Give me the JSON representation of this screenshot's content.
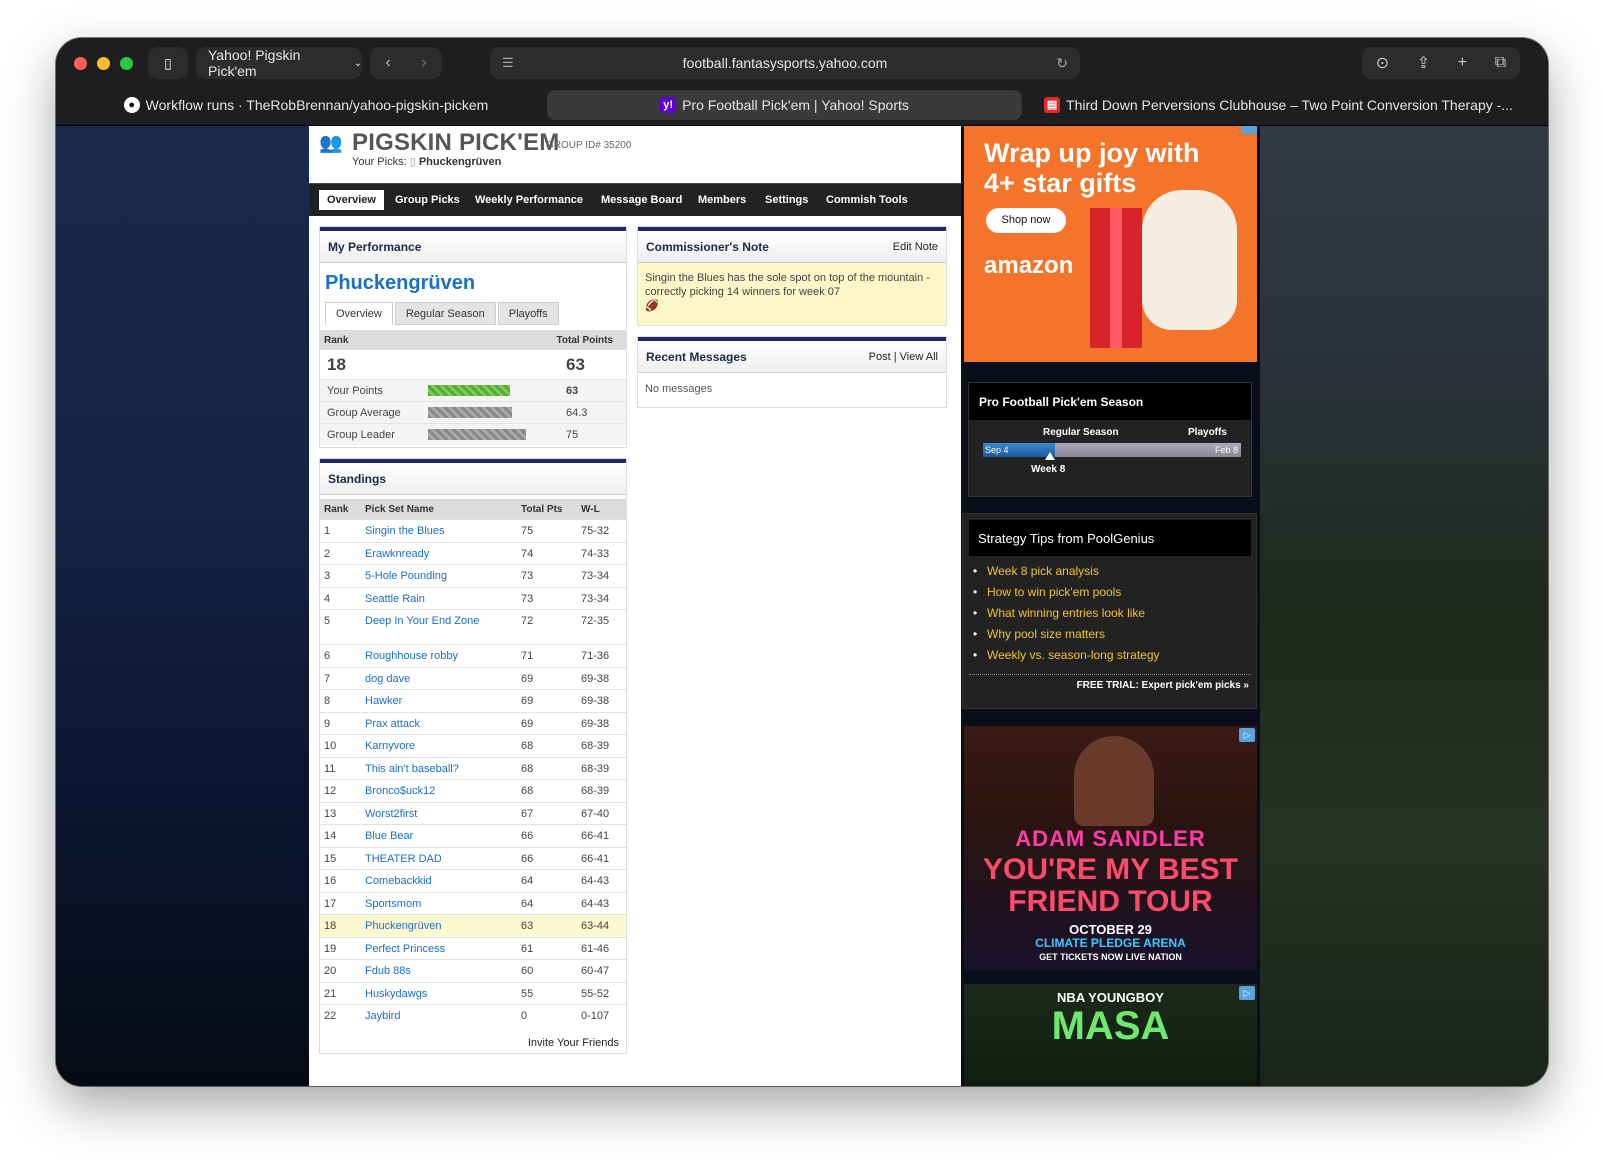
{
  "browser": {
    "tab_group": "Yahoo! Pigskin Pick'em",
    "address": "football.fantasysports.yahoo.com",
    "tabs": [
      {
        "label": "Workflow runs · TheRobBrennan/yahoo-pigskin-pickem",
        "icon": "github-icon"
      },
      {
        "label": "Pro Football Pick'em | Yahoo! Sports",
        "icon": "yahoo-icon"
      },
      {
        "label": "Third Down Perversions Clubhouse – Two Point Conversion Therapy -...",
        "icon": "tab-icon"
      }
    ]
  },
  "header": {
    "brand": "PIGSKIN PICK'EM",
    "group_id": "GROUP ID# 35200",
    "your_picks_label": "Your Picks:",
    "your_picks_value": "Phuckengrüven"
  },
  "nav": [
    "Overview",
    "Group Picks",
    "Weekly Performance",
    "Message Board",
    "Members",
    "Settings",
    "Commish Tools"
  ],
  "performance": {
    "title": "My Performance",
    "name": "Phuckengrüven",
    "tabs": [
      "Overview",
      "Regular Season",
      "Playoffs"
    ],
    "rank_label": "Rank",
    "points_label": "Total Points",
    "rank": "18",
    "total_points": "63",
    "stats": [
      {
        "label": "Your Points",
        "value": "63",
        "pct": 0.84
      },
      {
        "label": "Group Average",
        "value": "64.3",
        "pct": 0.86
      },
      {
        "label": "Group Leader",
        "value": "75",
        "pct": 1.0
      }
    ]
  },
  "standings": {
    "title": "Standings",
    "headers": [
      "Rank",
      "Pick Set Name",
      "Total Pts",
      "W-L"
    ],
    "rows": [
      [
        "1",
        "Singin the Blues",
        "75",
        "75-32"
      ],
      [
        "2",
        "Erawknready",
        "74",
        "74-33"
      ],
      [
        "3",
        "5-Hole Pounding",
        "73",
        "73-34"
      ],
      [
        "4",
        "Seattle Rain",
        "73",
        "73-34"
      ],
      [
        "5",
        "Deep In Your End Zone",
        "72",
        "72-35"
      ],
      [
        "6",
        "Roughhouse robby",
        "71",
        "71-36"
      ],
      [
        "7",
        "dog dave",
        "69",
        "69-38"
      ],
      [
        "8",
        "Hawker",
        "69",
        "69-38"
      ],
      [
        "9",
        "Prax attack",
        "69",
        "69-38"
      ],
      [
        "10",
        "Karnyvore",
        "68",
        "68-39"
      ],
      [
        "11",
        "This ain't baseball?",
        "68",
        "68-39"
      ],
      [
        "12",
        "Bronco$uck12",
        "68",
        "68-39"
      ],
      [
        "13",
        "Worst2first",
        "67",
        "67-40"
      ],
      [
        "14",
        "Blue Bear",
        "66",
        "66-41"
      ],
      [
        "15",
        "THEATER DAD",
        "66",
        "66-41"
      ],
      [
        "16",
        "Comebackkid",
        "64",
        "64-43"
      ],
      [
        "17",
        "Sportsmom",
        "64",
        "64-43"
      ],
      [
        "18",
        "Phuckengrüven",
        "63",
        "63-44"
      ],
      [
        "19",
        "Perfect Princess",
        "61",
        "61-46"
      ],
      [
        "20",
        "Fdub 88s",
        "60",
        "60-47"
      ],
      [
        "21",
        "Huskydawgs",
        "55",
        "55-52"
      ],
      [
        "22",
        "Jaybird",
        "0",
        "0-107"
      ]
    ],
    "invite": "Invite Your Friends"
  },
  "commish_note": {
    "title": "Commissioner's Note",
    "edit": "Edit Note",
    "text": "Singin the Blues has the sole spot on top of the mountain - correctly picking 14 winners for week 07"
  },
  "messages": {
    "title": "Recent Messages",
    "post": "Post",
    "view_all": "View All",
    "empty": "No messages"
  },
  "ad_amazon": {
    "headline": "Wrap up joy with 4+ star gifts",
    "cta": "Shop now",
    "brand": "amazon"
  },
  "season": {
    "title": "Pro Football Pick'em Season",
    "regular": "Regular Season",
    "playoffs": "Playoffs",
    "start": "Sep 4",
    "end": "Feb 8",
    "current": "Week 8",
    "progress": 0.28
  },
  "tips": {
    "title": "Strategy Tips from PoolGenius",
    "items": [
      "Week 8 pick analysis",
      "How to win pick'em pools",
      "What winning entries look like",
      "Why pool size matters",
      "Weekly vs. season-long strategy"
    ],
    "footer": "FREE TRIAL: Expert pick'em picks »"
  },
  "ad_sandler": {
    "line1": "ADAM SANDLER",
    "line2": "YOU'RE MY BEST FRIEND TOUR",
    "line3": "OCTOBER 29",
    "line4": "CLIMATE PLEDGE ARENA",
    "line5": "GET TICKETS NOW   LIVE NATION"
  },
  "ad_nba": {
    "line1": "NBA YOUNGBOY",
    "line2": "MASA"
  }
}
